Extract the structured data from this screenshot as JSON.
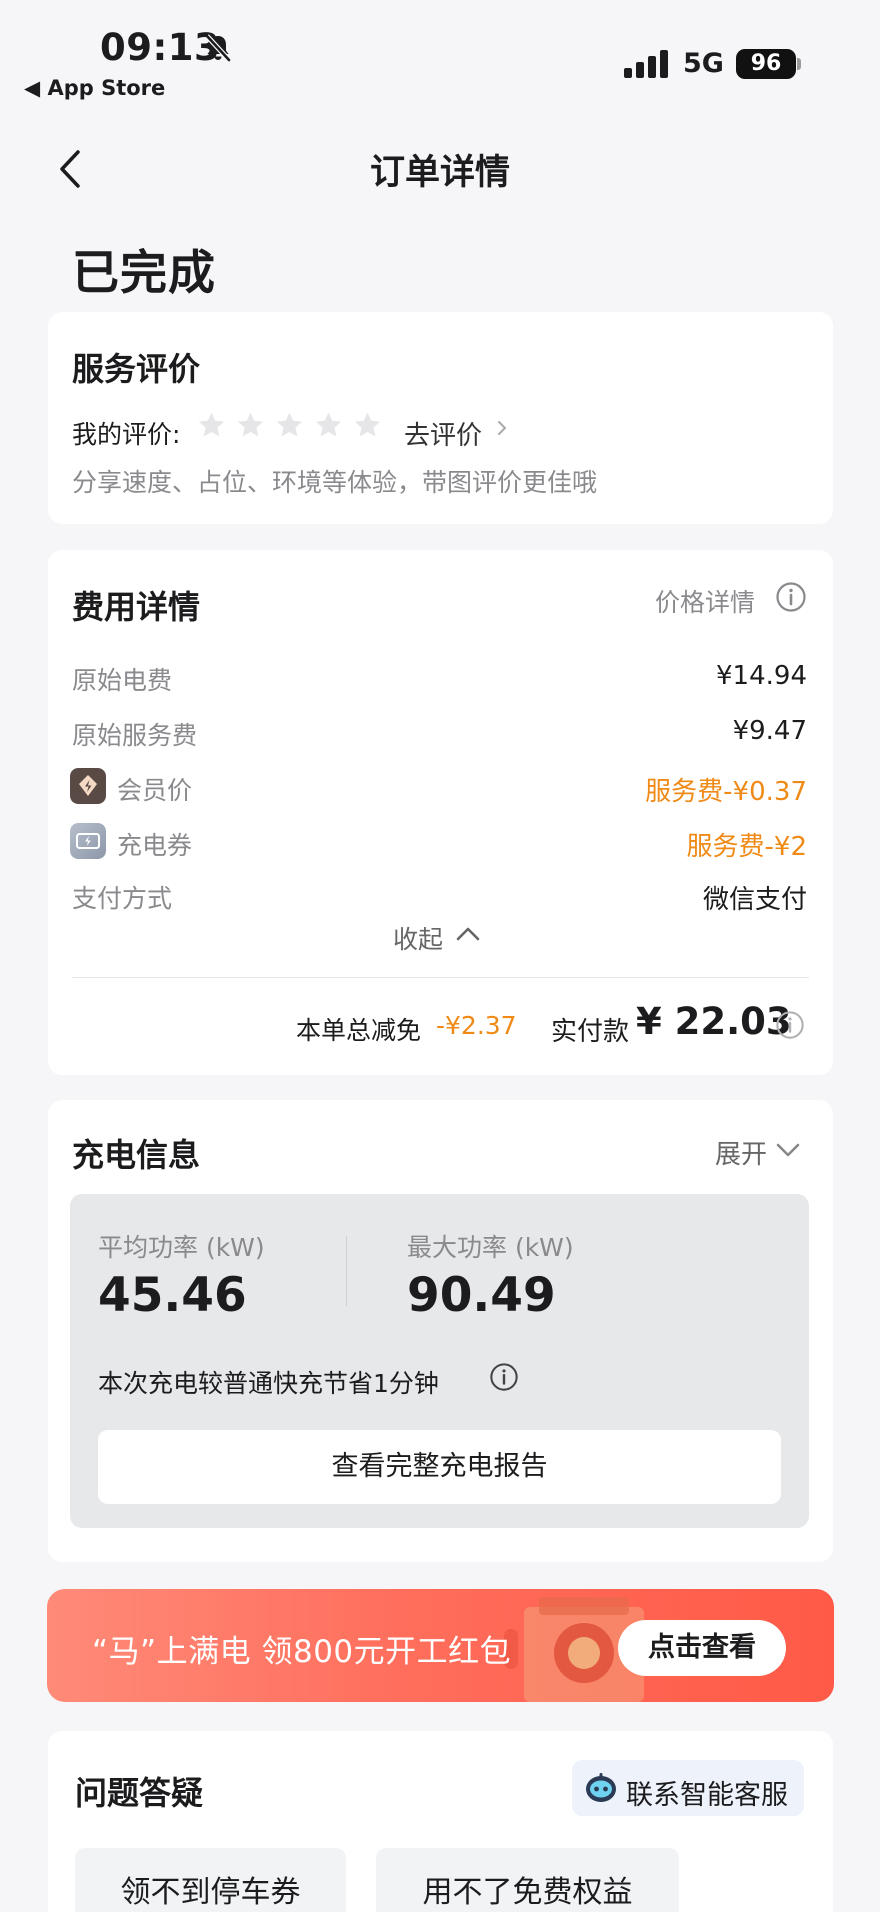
{
  "status_bar": {
    "time": "09:13",
    "back_app": "◀ App Store",
    "network": "5G",
    "battery": "96"
  },
  "nav": {
    "title": "订单详情"
  },
  "order_status": "已完成",
  "review": {
    "title": "服务评价",
    "my_review_label": "我的评价:",
    "rating": 0,
    "max_rating": 5,
    "go_review": "去评价",
    "hint": "分享速度、占位、环境等体验，带图评价更佳哦"
  },
  "fees": {
    "title": "费用详情",
    "price_detail": "价格详情",
    "rows": [
      {
        "label": "原始电费",
        "value": "¥14.94"
      },
      {
        "label": "原始服务费",
        "value": "¥9.47"
      },
      {
        "label": "会员价",
        "value": "服务费-¥0.37"
      },
      {
        "label": "充电券",
        "value": "服务费-¥2"
      },
      {
        "label": "支付方式",
        "value": "微信支付"
      }
    ],
    "collapse": "收起",
    "total_discount_label": "本单总减免",
    "total_discount": "-¥2.37",
    "paid_label": "实付款",
    "paid": "¥ 22.03",
    "accent_color": "#ef8a17"
  },
  "charging": {
    "title": "充电信息",
    "expand": "展开",
    "avg_power_label": "平均功率 (kW)",
    "avg_power": "45.46",
    "max_power_label": "最大功率 (kW)",
    "max_power": "90.49",
    "saving_text": "本次充电较普通快充节省1分钟",
    "report_button": "查看完整充电报告"
  },
  "banner": {
    "text": "“马”上满电 领800元开工红包",
    "button": "点击查看"
  },
  "faq": {
    "title": "问题答疑",
    "customer_service": "联系智能客服",
    "chips": [
      "领不到停车券",
      "用不了免费权益"
    ]
  }
}
